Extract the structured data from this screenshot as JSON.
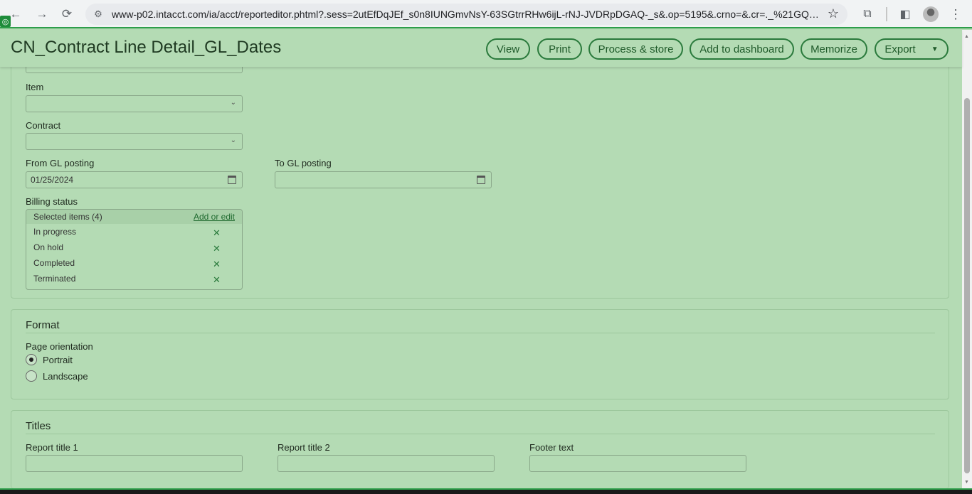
{
  "browser": {
    "url": "www-p02.intacct.com/ia/acct/reporteditor.phtml?.sess=2utEfDqJEf_s0n8IUNGmvNsY-63SGtrrRHw6ijL-rNJ-JVDRpDGAQ-_s&.op=5195&.crno=&.cr=._%21GQ_uH...",
    "ext_badge": "◎"
  },
  "header": {
    "title": "CN_Contract Line Detail_GL_Dates",
    "buttons": {
      "view": "View",
      "print": "Print",
      "process_store": "Process & store",
      "add_dashboard": "Add to dashboard",
      "memorize": "Memorize",
      "export": "Export"
    }
  },
  "filters": {
    "item_label": "Item",
    "contract_label": "Contract",
    "from_gl_label": "From GL posting",
    "from_gl_value": "01/25/2024",
    "to_gl_label": "To GL posting",
    "to_gl_value": "",
    "billing_status_label": "Billing status",
    "billing": {
      "selected": "Selected items (4)",
      "add_edit": "Add or edit",
      "items": [
        "In progress",
        "On hold",
        "Completed",
        "Terminated"
      ]
    }
  },
  "format": {
    "title": "Format",
    "orientation_label": "Page orientation",
    "portrait": "Portrait",
    "landscape": "Landscape",
    "selected": "Portrait"
  },
  "titles": {
    "title": "Titles",
    "report_title_1": "Report title 1",
    "report_title_2": "Report title 2",
    "footer_text": "Footer text"
  }
}
